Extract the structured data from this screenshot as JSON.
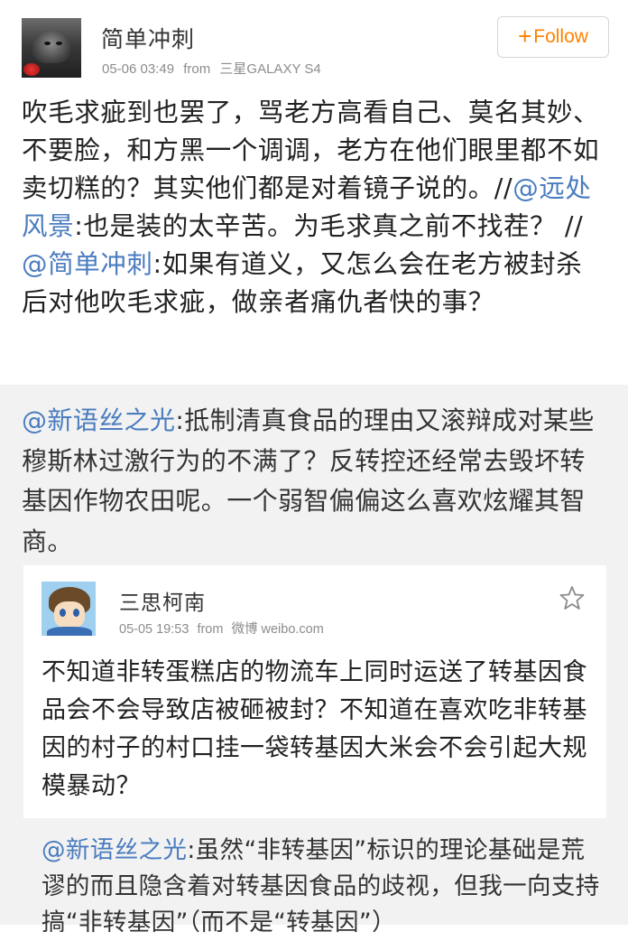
{
  "post": {
    "author": "简单冲刺",
    "time": "05-06 03:49",
    "from_label": "from",
    "device": "三星GALAXY S4",
    "follow_plus": "+",
    "follow_label": "Follow",
    "text_1": "吹毛求疵到也罢了，骂老方高看自己、莫名其妙、不要脸，和方黑一个调调，老方在他们眼里都不如卖切糕的？其实他们都是对着镜子说的。//",
    "mention_1": "@远处风景",
    "text_2": ":也是装的太辛苦。为毛求真之前不找茬？ //",
    "mention_2": "@简单冲刺",
    "text_3": ":如果有道义，又怎么会在老方被封杀后对他吹毛求疵，做亲者痛仇者快的事？"
  },
  "repost": {
    "mention": "@新语丝之光",
    "text": ":抵制清真食品的理由又滚辩成对某些穆斯林过激行为的不满了？反转控还经常去毁坏转基因作物农田呢。一个弱智偏偏这么喜欢炫耀其智商。"
  },
  "card": {
    "author": "三思柯南",
    "time": "05-05 19:53",
    "from_label": "from",
    "source": "微博 weibo.com",
    "text": "不知道非转蛋糕店的物流车上同时运送了转基因食品会不会导致店被砸被封？不知道在喜欢吃非转基因的村子的村口挂一袋转基因大米会不会引起大规模暴动？"
  },
  "reply": {
    "mention": "@新语丝之光",
    "text": ":虽然“非转基因”标识的理论基础是荒谬的而且隐含着对转基因食品的歧视，但我一向支持搞“非转基因”（而不是“转基因”）"
  },
  "colors": {
    "accent": "#ff8200",
    "mention": "#4a7cbf",
    "meta": "#8c8c8c",
    "repost_bg": "#f2f2f2"
  }
}
